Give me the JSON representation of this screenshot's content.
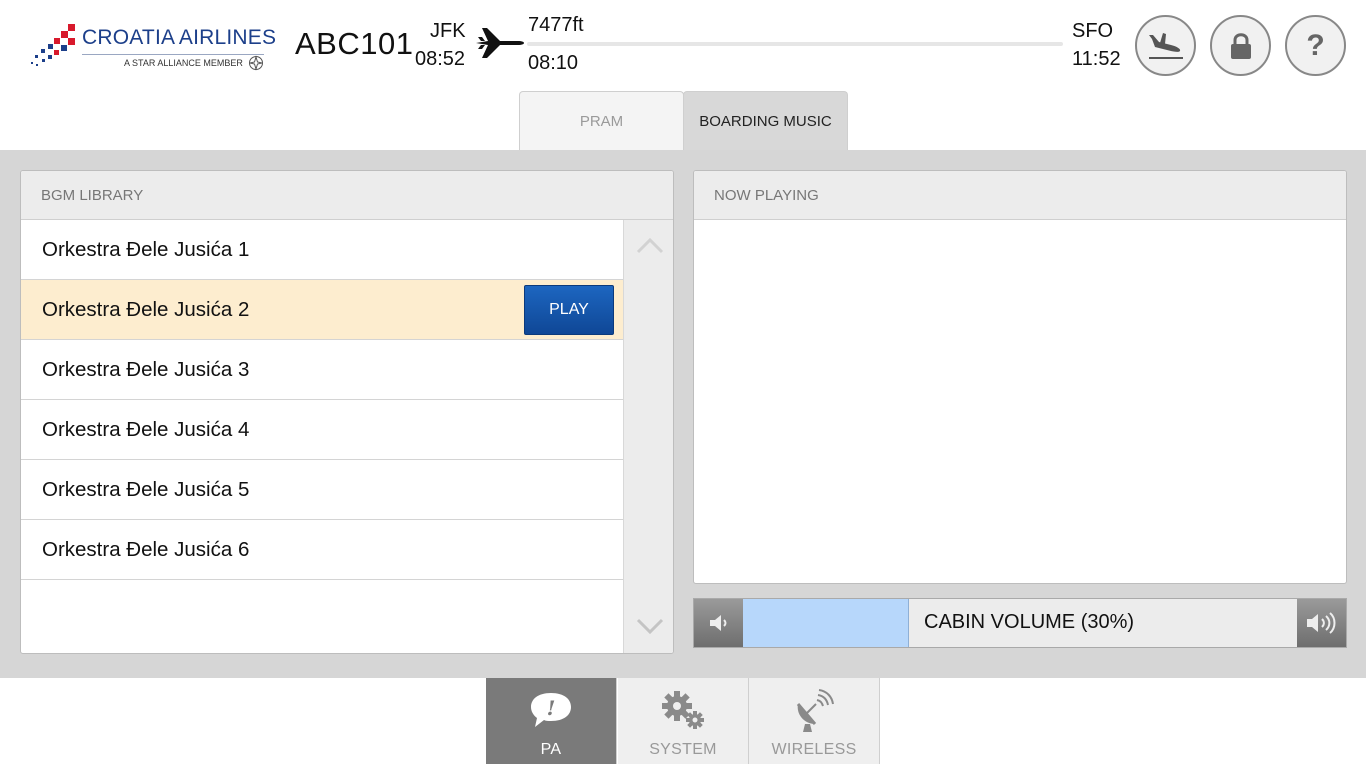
{
  "header": {
    "airline_name": "CROATIA AIRLINES",
    "alliance_text": "A STAR ALLIANCE MEMBER",
    "flight_number": "ABC101",
    "origin": {
      "code": "JFK",
      "time": "08:52"
    },
    "destination": {
      "code": "SFO",
      "time": "11:52"
    },
    "altitude": "7477ft",
    "elapsed_time": "08:10",
    "buttons": [
      "landing-icon",
      "lock-icon",
      "help-icon"
    ],
    "help_label": "?"
  },
  "tabs": [
    {
      "label": "PRAM",
      "active": false
    },
    {
      "label": "BOARDING MUSIC",
      "active": true
    }
  ],
  "library": {
    "title": "BGM LIBRARY",
    "tracks": [
      "Orkestra Đele Jusića 1",
      "Orkestra Đele Jusića 2",
      "Orkestra Đele Jusića 3",
      "Orkestra Đele Jusića 4",
      "Orkestra Đele Jusića 5",
      "Orkestra Đele Jusića 6"
    ],
    "selected_index": 1,
    "play_label": "PLAY"
  },
  "now_playing": {
    "title": "NOW PLAYING"
  },
  "volume": {
    "label": "CABIN VOLUME (30%)",
    "level_percent": 30
  },
  "bottom_nav": [
    {
      "label": "PA",
      "icon": "speech-bubble-icon",
      "active": true
    },
    {
      "label": "SYSTEM",
      "icon": "gears-icon",
      "active": false
    },
    {
      "label": "WIRELESS",
      "icon": "satellite-dish-icon",
      "active": false
    }
  ],
  "colors": {
    "brand_blue": "#1c3f8a",
    "brand_red": "#d8192c",
    "selected_row": "#fdedcf",
    "play_button": "#1d66c0",
    "volume_fill": "#b7d7fb"
  }
}
